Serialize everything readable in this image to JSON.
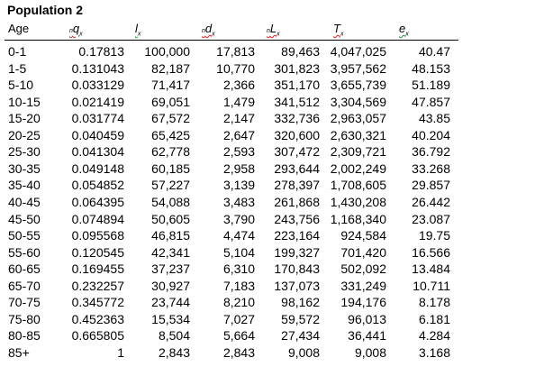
{
  "title": "Population 2",
  "headers": {
    "age": "Age",
    "qx": {
      "pre": "n",
      "main": "q",
      "sub": "x"
    },
    "lx": {
      "main": "l",
      "sub": "x"
    },
    "dx": {
      "pre": "n",
      "main": "d",
      "sub": "x"
    },
    "Lx": {
      "pre": "n",
      "main": "L",
      "sub": "x"
    },
    "Tx": {
      "main": "T",
      "sub": "x"
    },
    "ex": {
      "main": "e",
      "sub": "x"
    }
  },
  "rows": [
    [
      "0-1",
      "0.17813",
      "100,000",
      "17,813",
      "89,463",
      "4,047,025",
      "40.47"
    ],
    [
      "1-5",
      "0.131043",
      "82,187",
      "10,770",
      "301,823",
      "3,957,562",
      "48.153"
    ],
    [
      "5-10",
      "0.033129",
      "71,417",
      "2,366",
      "351,170",
      "3,655,739",
      "51.189"
    ],
    [
      "10-15",
      "0.021419",
      "69,051",
      "1,479",
      "341,512",
      "3,304,569",
      "47.857"
    ],
    [
      "15-20",
      "0.031774",
      "67,572",
      "2,147",
      "332,736",
      "2,963,057",
      "43.85"
    ],
    [
      "20-25",
      "0.040459",
      "65,425",
      "2,647",
      "320,600",
      "2,630,321",
      "40.204"
    ],
    [
      "25-30",
      "0.041304",
      "62,778",
      "2,593",
      "307,472",
      "2,309,721",
      "36.792"
    ],
    [
      "30-35",
      "0.049148",
      "60,185",
      "2,958",
      "293,644",
      "2,002,249",
      "33.268"
    ],
    [
      "35-40",
      "0.054852",
      "57,227",
      "3,139",
      "278,397",
      "1,708,605",
      "29.857"
    ],
    [
      "40-45",
      "0.064395",
      "54,088",
      "3,483",
      "261,868",
      "1,430,208",
      "26.442"
    ],
    [
      "45-50",
      "0.074894",
      "50,605",
      "3,790",
      "243,756",
      "1,168,340",
      "23.087"
    ],
    [
      "50-55",
      "0.095568",
      "46,815",
      "4,474",
      "223,164",
      "924,584",
      "19.75"
    ],
    [
      "55-60",
      "0.120545",
      "42,341",
      "5,104",
      "199,327",
      "701,420",
      "16.566"
    ],
    [
      "60-65",
      "0.169455",
      "37,237",
      "6,310",
      "170,843",
      "502,092",
      "13.484"
    ],
    [
      "65-70",
      "0.232257",
      "30,927",
      "7,183",
      "137,073",
      "331,249",
      "10.711"
    ],
    [
      "70-75",
      "0.345772",
      "23,744",
      "8,210",
      "98,162",
      "194,176",
      "8.178"
    ],
    [
      "75-80",
      "0.452363",
      "15,534",
      "7,027",
      "59,572",
      "96,013",
      "6.181"
    ],
    [
      "80-85",
      "0.665805",
      "8,504",
      "5,664",
      "27,434",
      "36,441",
      "4.284"
    ],
    [
      "85+",
      "1",
      "2,843",
      "2,843",
      "9,008",
      "9,008",
      "3.168"
    ]
  ]
}
